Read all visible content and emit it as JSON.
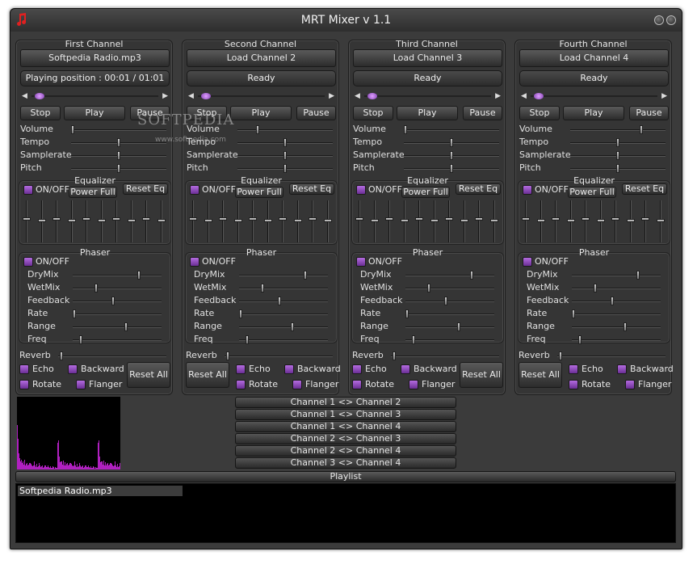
{
  "window": {
    "title": "MRT Mixer v 1.1"
  },
  "channels": [
    {
      "title": "First Channel",
      "load_label": "Softpedia Radio.mp3",
      "status": "Playing position : 00:01 / 01:01",
      "stop": "Stop",
      "play": "Play",
      "pause": "Pause",
      "sliders": [
        "Volume",
        "Tempo",
        "Samplerate",
        "Pitch"
      ],
      "eq_title": "Equalizer",
      "eq_onoff": "ON/OFF",
      "eq_power": "Power Full",
      "eq_reset": "Reset Eq",
      "phaser_title": "Phaser",
      "phaser_onoff": "ON/OFF",
      "phaser_sliders": [
        "DryMix",
        "WetMix",
        "Feedback",
        "Rate",
        "Range",
        "Freq"
      ],
      "reverb": "Reverb",
      "echo": "Echo",
      "backward": "Backward",
      "rotate": "Rotate",
      "flanger": "Flanger",
      "reset_all": "Reset All"
    },
    {
      "title": "Second Channel",
      "load_label": "Load Channel 2",
      "status": "Ready",
      "stop": "Stop",
      "play": "Play",
      "pause": "Pause",
      "sliders": [
        "Volume",
        "Tempo",
        "Samplerate",
        "Pitch"
      ],
      "eq_title": "Equalizer",
      "eq_onoff": "ON/OFF",
      "eq_power": "Power Full",
      "eq_reset": "Reset Eq",
      "phaser_title": "Phaser",
      "phaser_onoff": "ON/OFF",
      "phaser_sliders": [
        "DryMix",
        "WetMix",
        "Feedback",
        "Rate",
        "Range",
        "Freq"
      ],
      "reverb": "Reverb",
      "echo": "Echo",
      "backward": "Backward",
      "rotate": "Rotate",
      "flanger": "Flanger",
      "reset_all": "Reset All"
    },
    {
      "title": "Third Channel",
      "load_label": "Load Channel 3",
      "status": "Ready",
      "stop": "Stop",
      "play": "Play",
      "pause": "Pause",
      "sliders": [
        "Volume",
        "Tempo",
        "Samplerate",
        "Pitch"
      ],
      "eq_title": "Equalizer",
      "eq_onoff": "ON/OFF",
      "eq_power": "Power Full",
      "eq_reset": "Reset Eq",
      "phaser_title": "Phaser",
      "phaser_onoff": "ON/OFF",
      "phaser_sliders": [
        "DryMix",
        "WetMix",
        "Feedback",
        "Rate",
        "Range",
        "Freq"
      ],
      "reverb": "Reverb",
      "echo": "Echo",
      "backward": "Backward",
      "rotate": "Rotate",
      "flanger": "Flanger",
      "reset_all": "Reset All"
    },
    {
      "title": "Fourth Channel",
      "load_label": "Load Channel 4",
      "status": "Ready",
      "stop": "Stop",
      "play": "Play",
      "pause": "Pause",
      "sliders": [
        "Volume",
        "Tempo",
        "Samplerate",
        "Pitch"
      ],
      "eq_title": "Equalizer",
      "eq_onoff": "ON/OFF",
      "eq_power": "Power Full",
      "eq_reset": "Reset Eq",
      "phaser_title": "Phaser",
      "phaser_onoff": "ON/OFF",
      "phaser_sliders": [
        "DryMix",
        "WetMix",
        "Feedback",
        "Rate",
        "Range",
        "Freq"
      ],
      "reverb": "Reverb",
      "echo": "Echo",
      "backward": "Backward",
      "rotate": "Rotate",
      "flanger": "Flanger",
      "reset_all": "Reset All"
    }
  ],
  "swap_buttons": [
    "Channel 1 <> Channel 2",
    "Channel 1 <> Channel 3",
    "Channel 1 <> Channel 4",
    "Channel 2 <> Channel 3",
    "Channel 2 <> Channel 4",
    "Channel 3 <> Channel 4"
  ],
  "playlist": {
    "title": "Playlist",
    "items": [
      "Softpedia Radio.mp3"
    ]
  },
  "watermark": {
    "text": "SOFTPEDIA",
    "sub": "www.softpedia.com"
  },
  "colors": {
    "accent": "#a050d0",
    "background": "#3b3b3b",
    "visualizer": "#b020c0"
  }
}
